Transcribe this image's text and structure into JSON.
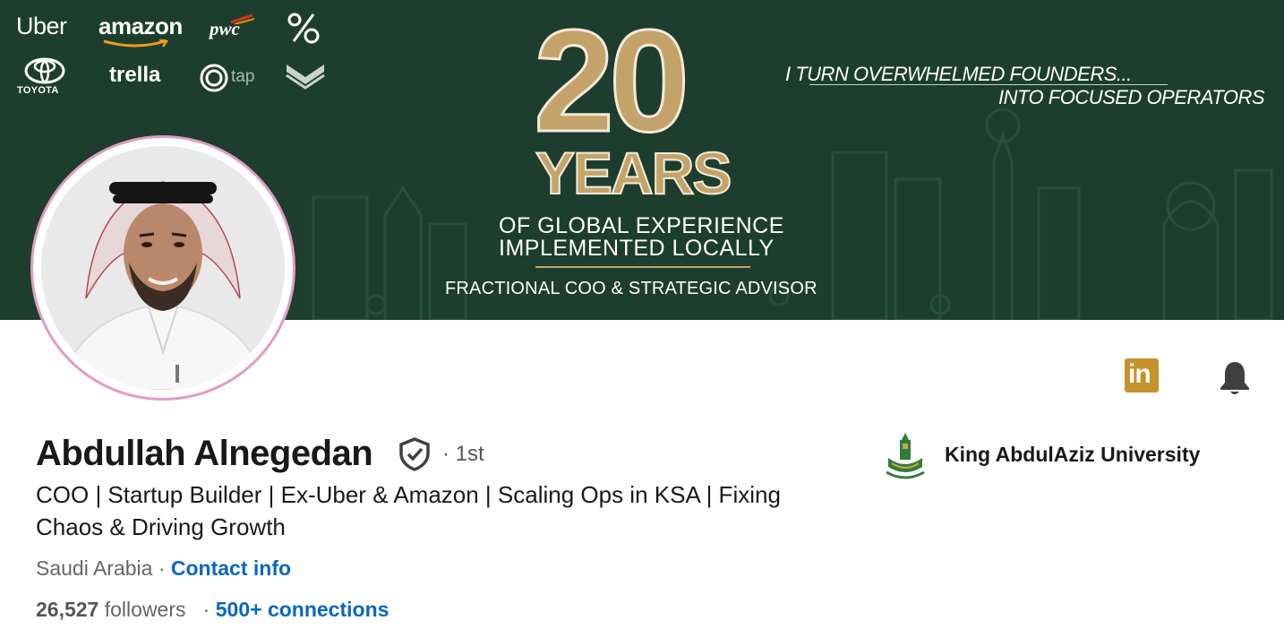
{
  "banner": {
    "logos": {
      "uber": "Uber",
      "amazon": "amazon",
      "pwc": "pwc",
      "toyota": "TOYOTA",
      "trella": "trella",
      "tap": "tap"
    },
    "big_number": "20",
    "years": "YEARS",
    "experience_line1": "OF GLOBAL EXPERIENCE",
    "experience_line2": "IMPLEMENTED LOCALLY",
    "role": "FRACTIONAL COO & STRATEGIC ADVISOR",
    "tagline_line1": "I TURN OVERWHELMED FOUNDERS...",
    "tagline_line2": "INTO FOCUSED OPERATORS",
    "colors": {
      "background": "#1d3e2e",
      "gold": "#c4a36b"
    }
  },
  "profile": {
    "name": "Abdullah Alnegedan",
    "degree": "· 1st",
    "headline": "COO | Startup Builder | Ex-Uber & Amazon | Scaling Ops in KSA | Fixing Chaos & Driving Growth",
    "location": "Saudi Arabia",
    "separator": " · ",
    "contact_info": "Contact info",
    "followers_count": "26,527",
    "followers_label": " followers",
    "connections_separator": "   · ",
    "connections": "500+ connections"
  },
  "education": {
    "name": "King AbdulAziz University"
  },
  "actions": {
    "linkedin_label": "in"
  },
  "icons": {
    "verified": "verified-shield-icon",
    "bell": "bell-icon",
    "linkedin": "linkedin-icon"
  },
  "colors": {
    "link": "#0a66c2",
    "avatar_ring": "#e39bc2",
    "linkedin_badge": "#c4932b"
  }
}
